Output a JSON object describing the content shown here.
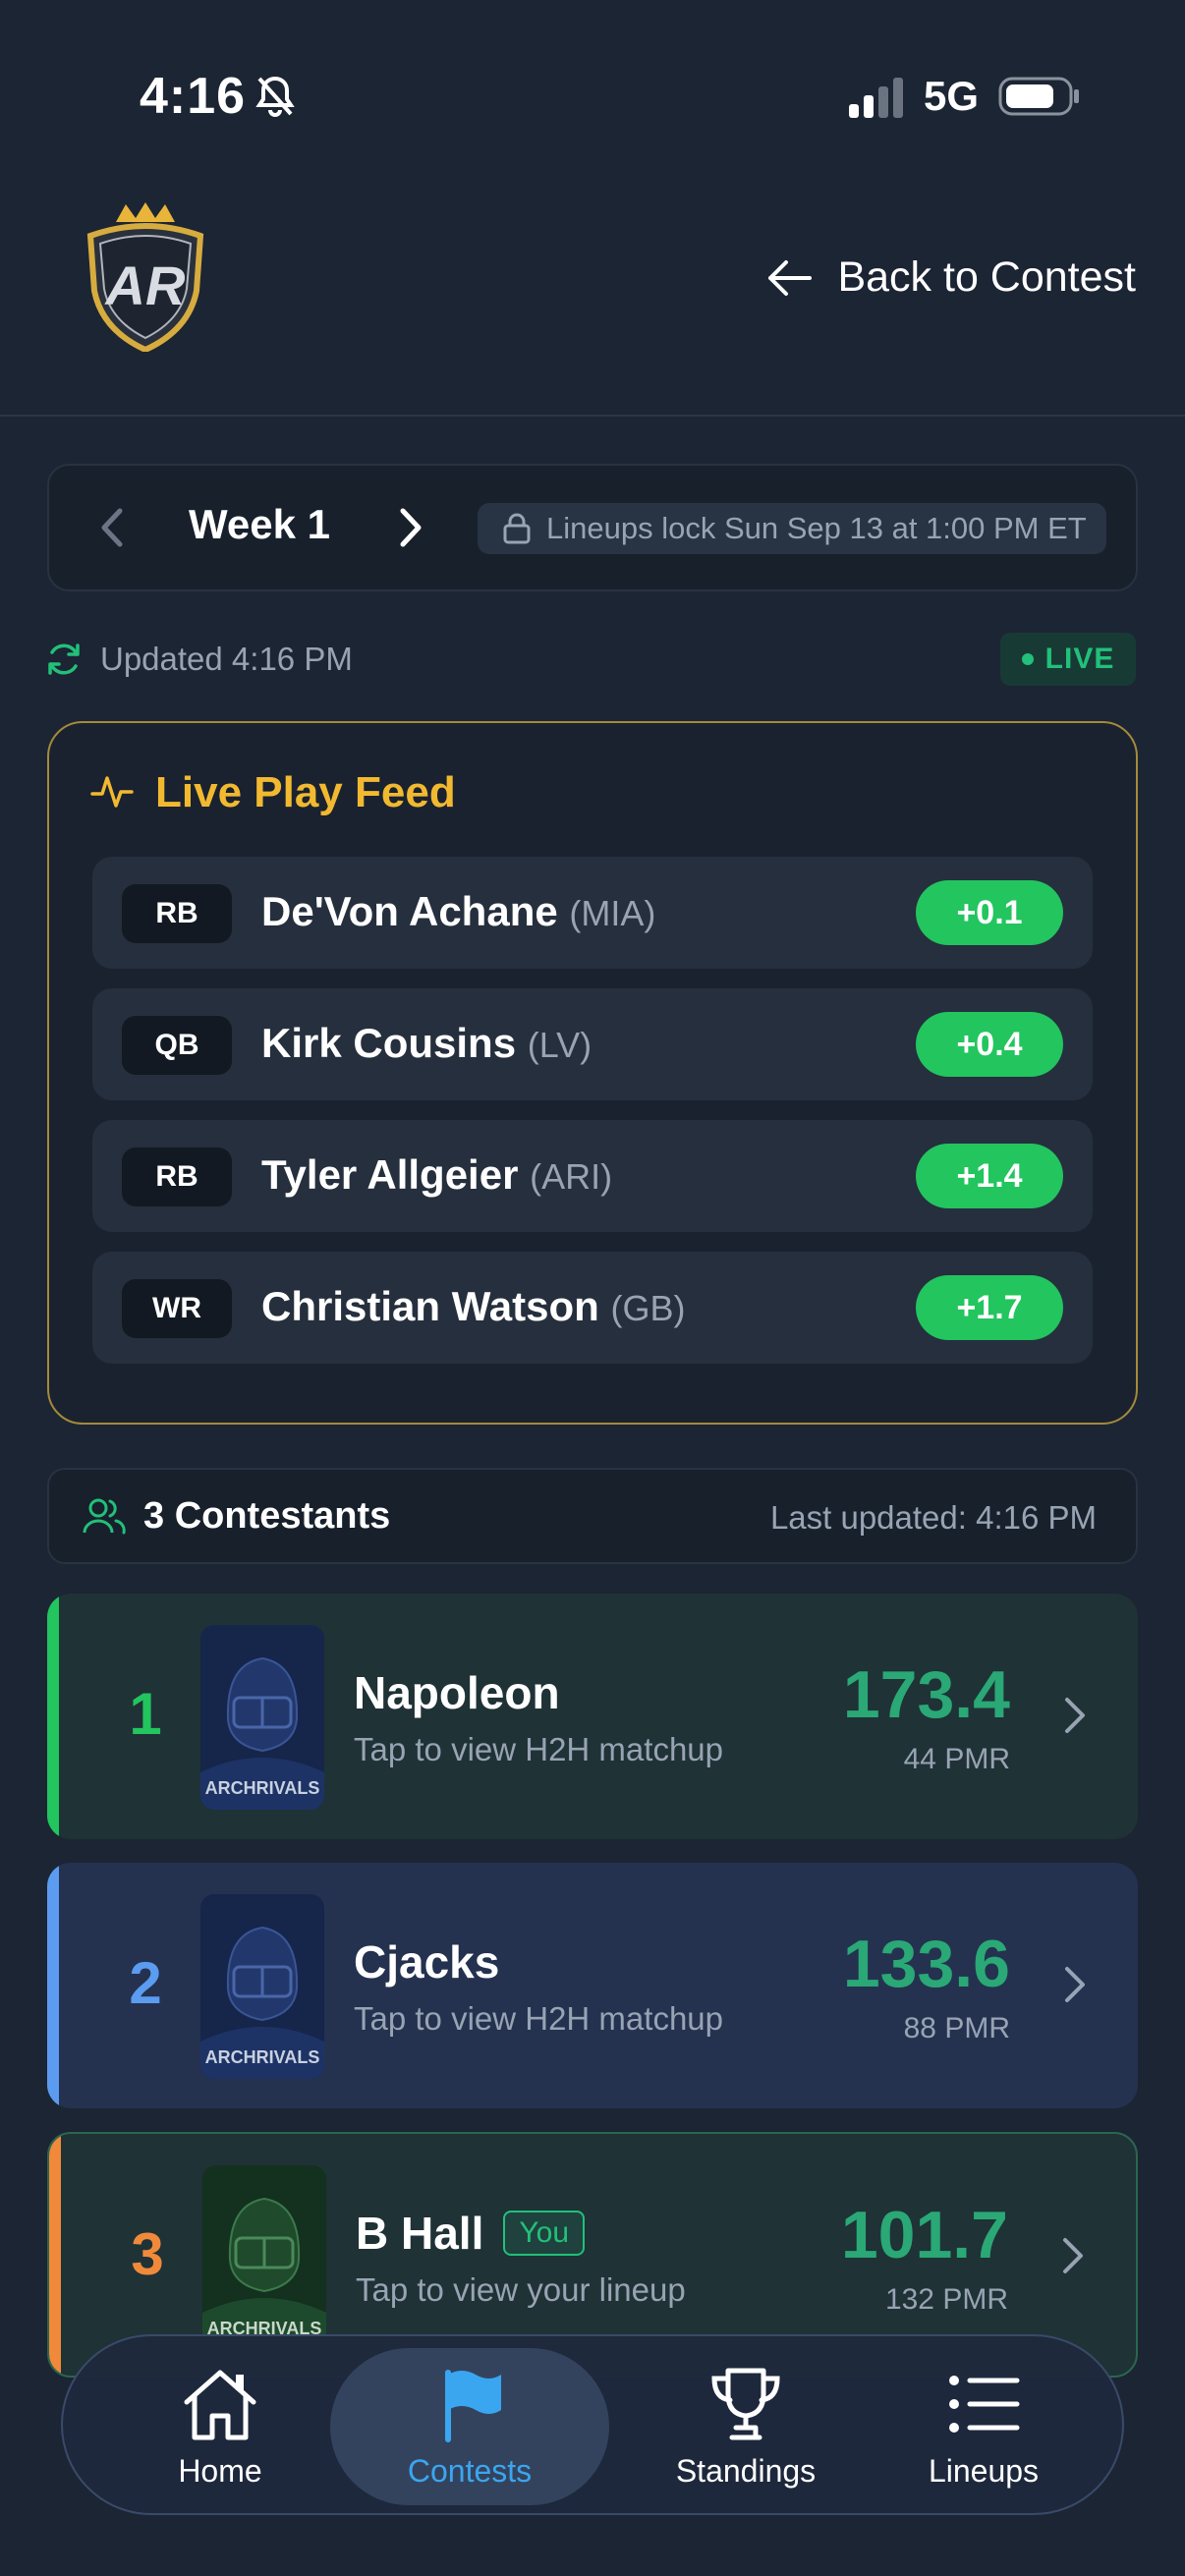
{
  "status_bar": {
    "time": "4:16",
    "network": "5G",
    "icons": [
      "bell-slash-icon",
      "signal-icon",
      "battery-icon"
    ]
  },
  "header": {
    "logo_text": "AR",
    "back_label": "Back to Contest"
  },
  "week_selector": {
    "week_label": "Week 1",
    "lock_text": "Lineups lock Sun Sep 13 at 1:00 PM ET"
  },
  "update_row": {
    "updated_text": "Updated 4:16 PM",
    "live_label": "LIVE"
  },
  "live_feed": {
    "title": "Live Play Feed",
    "rows": [
      {
        "pos": "RB",
        "name": "De'Von Achane",
        "team": "(MIA)",
        "points": "+0.1"
      },
      {
        "pos": "QB",
        "name": "Kirk Cousins",
        "team": "(LV)",
        "points": "+0.4"
      },
      {
        "pos": "RB",
        "name": "Tyler Allgeier",
        "team": "(ARI)",
        "points": "+1.4"
      },
      {
        "pos": "WR",
        "name": "Christian Watson",
        "team": "(GB)",
        "points": "+1.7"
      }
    ]
  },
  "contestants": {
    "label": "3 Contestants",
    "last_updated": "Last updated: 4:16 PM",
    "list": [
      {
        "rank": "1",
        "name": "Napoleon",
        "sub": "Tap to view H2H matchup",
        "score": "173.4",
        "pmr": "44 PMR",
        "avatar_text": "ARCHRIVALS",
        "you": ""
      },
      {
        "rank": "2",
        "name": "Cjacks",
        "sub": "Tap to view H2H matchup",
        "score": "133.6",
        "pmr": "88 PMR",
        "avatar_text": "ARCHRIVALS",
        "you": ""
      },
      {
        "rank": "3",
        "name": "B Hall",
        "sub": "Tap to view your lineup",
        "score": "101.7",
        "pmr": "132 PMR",
        "avatar_text": "ARCHRIVALS",
        "you": "You"
      }
    ]
  },
  "bottom_nav": {
    "items": [
      {
        "label": "Home",
        "icon": "home-icon"
      },
      {
        "label": "Contests",
        "icon": "flag-icon",
        "active": true
      },
      {
        "label": "Standings",
        "icon": "trophy-icon"
      },
      {
        "label": "Lineups",
        "icon": "list-icon"
      }
    ]
  },
  "colors": {
    "background": "#1c2533",
    "accent_gold": "#f2b930",
    "live_green": "#22c07a",
    "points_green": "#22c55e",
    "score_green": "#2aa876",
    "active_blue": "#3aa6f0",
    "rank1": "#22c55e",
    "rank2": "#5b9cf0",
    "rank3": "#f08a3a"
  }
}
